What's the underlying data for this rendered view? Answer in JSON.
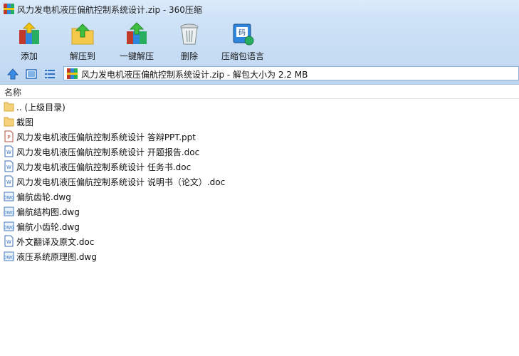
{
  "window": {
    "title": "风力发电机液压偏航控制系统设计.zip - 360压缩"
  },
  "toolbar": {
    "buttons": [
      {
        "label": "添加",
        "icon": "add-archive-icon"
      },
      {
        "label": "解压到",
        "icon": "extract-to-folder-icon"
      },
      {
        "label": "一键解压",
        "icon": "one-click-extract-icon"
      },
      {
        "label": "删除",
        "icon": "trash-bin-icon"
      },
      {
        "label": "压缩包语言",
        "icon": "archive-language-icon"
      }
    ]
  },
  "nav": {
    "path": "风力发电机液压偏航控制系统设计.zip - 解包大小为 2.2 MB",
    "icons": [
      "up-arrow-icon",
      "thumbnail-view-icon",
      "list-view-icon"
    ]
  },
  "list": {
    "header": "名称",
    "items": [
      {
        "name": ".. (上级目录)",
        "type": "folder"
      },
      {
        "name": "截图",
        "type": "folder"
      },
      {
        "name": "风力发电机液压偏航控制系统设计 答辩PPT.ppt",
        "type": "ppt"
      },
      {
        "name": "风力发电机液压偏航控制系统设计 开题报告.doc",
        "type": "doc"
      },
      {
        "name": "风力发电机液压偏航控制系统设计 任务书.doc",
        "type": "doc"
      },
      {
        "name": "风力发电机液压偏航控制系统设计 说明书（论文）.doc",
        "type": "doc"
      },
      {
        "name": "偏航齿轮.dwg",
        "type": "dwg"
      },
      {
        "name": "偏航结构图.dwg",
        "type": "dwg"
      },
      {
        "name": "偏航小齿轮.dwg",
        "type": "dwg"
      },
      {
        "name": "外文翻译及原文.doc",
        "type": "doc"
      },
      {
        "name": "液压系统原理图.dwg",
        "type": "dwg"
      }
    ]
  },
  "colors": {
    "accent": "#2d6fc4",
    "toolbar_bg": "#cfe2f7",
    "folder": "#f5d27a"
  }
}
